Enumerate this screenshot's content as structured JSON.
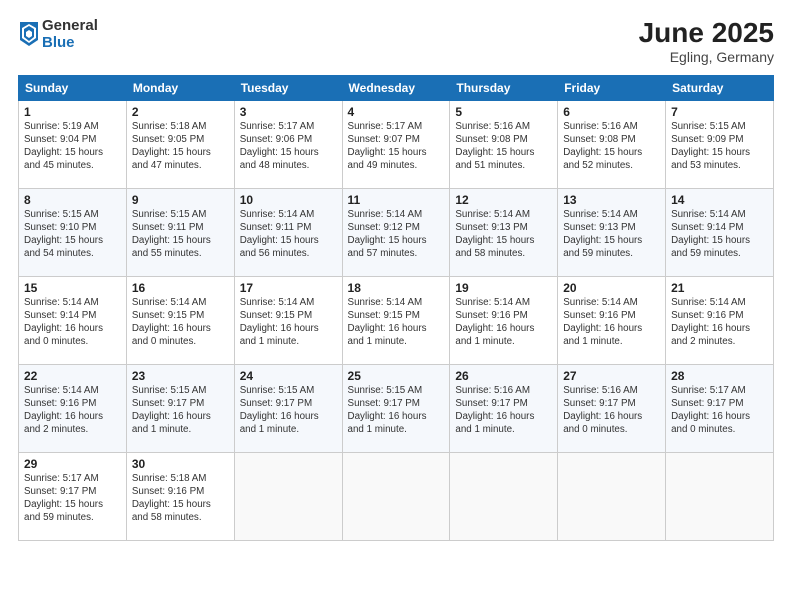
{
  "logo": {
    "general": "General",
    "blue": "Blue"
  },
  "title": "June 2025",
  "location": "Egling, Germany",
  "days_of_week": [
    "Sunday",
    "Monday",
    "Tuesday",
    "Wednesday",
    "Thursday",
    "Friday",
    "Saturday"
  ],
  "weeks": [
    [
      {
        "day": "1",
        "info": "Sunrise: 5:19 AM\nSunset: 9:04 PM\nDaylight: 15 hours\nand 45 minutes."
      },
      {
        "day": "2",
        "info": "Sunrise: 5:18 AM\nSunset: 9:05 PM\nDaylight: 15 hours\nand 47 minutes."
      },
      {
        "day": "3",
        "info": "Sunrise: 5:17 AM\nSunset: 9:06 PM\nDaylight: 15 hours\nand 48 minutes."
      },
      {
        "day": "4",
        "info": "Sunrise: 5:17 AM\nSunset: 9:07 PM\nDaylight: 15 hours\nand 49 minutes."
      },
      {
        "day": "5",
        "info": "Sunrise: 5:16 AM\nSunset: 9:08 PM\nDaylight: 15 hours\nand 51 minutes."
      },
      {
        "day": "6",
        "info": "Sunrise: 5:16 AM\nSunset: 9:08 PM\nDaylight: 15 hours\nand 52 minutes."
      },
      {
        "day": "7",
        "info": "Sunrise: 5:15 AM\nSunset: 9:09 PM\nDaylight: 15 hours\nand 53 minutes."
      }
    ],
    [
      {
        "day": "8",
        "info": "Sunrise: 5:15 AM\nSunset: 9:10 PM\nDaylight: 15 hours\nand 54 minutes."
      },
      {
        "day": "9",
        "info": "Sunrise: 5:15 AM\nSunset: 9:11 PM\nDaylight: 15 hours\nand 55 minutes."
      },
      {
        "day": "10",
        "info": "Sunrise: 5:14 AM\nSunset: 9:11 PM\nDaylight: 15 hours\nand 56 minutes."
      },
      {
        "day": "11",
        "info": "Sunrise: 5:14 AM\nSunset: 9:12 PM\nDaylight: 15 hours\nand 57 minutes."
      },
      {
        "day": "12",
        "info": "Sunrise: 5:14 AM\nSunset: 9:13 PM\nDaylight: 15 hours\nand 58 minutes."
      },
      {
        "day": "13",
        "info": "Sunrise: 5:14 AM\nSunset: 9:13 PM\nDaylight: 15 hours\nand 59 minutes."
      },
      {
        "day": "14",
        "info": "Sunrise: 5:14 AM\nSunset: 9:14 PM\nDaylight: 15 hours\nand 59 minutes."
      }
    ],
    [
      {
        "day": "15",
        "info": "Sunrise: 5:14 AM\nSunset: 9:14 PM\nDaylight: 16 hours\nand 0 minutes."
      },
      {
        "day": "16",
        "info": "Sunrise: 5:14 AM\nSunset: 9:15 PM\nDaylight: 16 hours\nand 0 minutes."
      },
      {
        "day": "17",
        "info": "Sunrise: 5:14 AM\nSunset: 9:15 PM\nDaylight: 16 hours\nand 1 minute."
      },
      {
        "day": "18",
        "info": "Sunrise: 5:14 AM\nSunset: 9:15 PM\nDaylight: 16 hours\nand 1 minute."
      },
      {
        "day": "19",
        "info": "Sunrise: 5:14 AM\nSunset: 9:16 PM\nDaylight: 16 hours\nand 1 minute."
      },
      {
        "day": "20",
        "info": "Sunrise: 5:14 AM\nSunset: 9:16 PM\nDaylight: 16 hours\nand 1 minute."
      },
      {
        "day": "21",
        "info": "Sunrise: 5:14 AM\nSunset: 9:16 PM\nDaylight: 16 hours\nand 2 minutes."
      }
    ],
    [
      {
        "day": "22",
        "info": "Sunrise: 5:14 AM\nSunset: 9:16 PM\nDaylight: 16 hours\nand 2 minutes."
      },
      {
        "day": "23",
        "info": "Sunrise: 5:15 AM\nSunset: 9:17 PM\nDaylight: 16 hours\nand 1 minute."
      },
      {
        "day": "24",
        "info": "Sunrise: 5:15 AM\nSunset: 9:17 PM\nDaylight: 16 hours\nand 1 minute."
      },
      {
        "day": "25",
        "info": "Sunrise: 5:15 AM\nSunset: 9:17 PM\nDaylight: 16 hours\nand 1 minute."
      },
      {
        "day": "26",
        "info": "Sunrise: 5:16 AM\nSunset: 9:17 PM\nDaylight: 16 hours\nand 1 minute."
      },
      {
        "day": "27",
        "info": "Sunrise: 5:16 AM\nSunset: 9:17 PM\nDaylight: 16 hours\nand 0 minutes."
      },
      {
        "day": "28",
        "info": "Sunrise: 5:17 AM\nSunset: 9:17 PM\nDaylight: 16 hours\nand 0 minutes."
      }
    ],
    [
      {
        "day": "29",
        "info": "Sunrise: 5:17 AM\nSunset: 9:17 PM\nDaylight: 15 hours\nand 59 minutes."
      },
      {
        "day": "30",
        "info": "Sunrise: 5:18 AM\nSunset: 9:16 PM\nDaylight: 15 hours\nand 58 minutes."
      },
      {
        "day": "",
        "info": ""
      },
      {
        "day": "",
        "info": ""
      },
      {
        "day": "",
        "info": ""
      },
      {
        "day": "",
        "info": ""
      },
      {
        "day": "",
        "info": ""
      }
    ]
  ]
}
